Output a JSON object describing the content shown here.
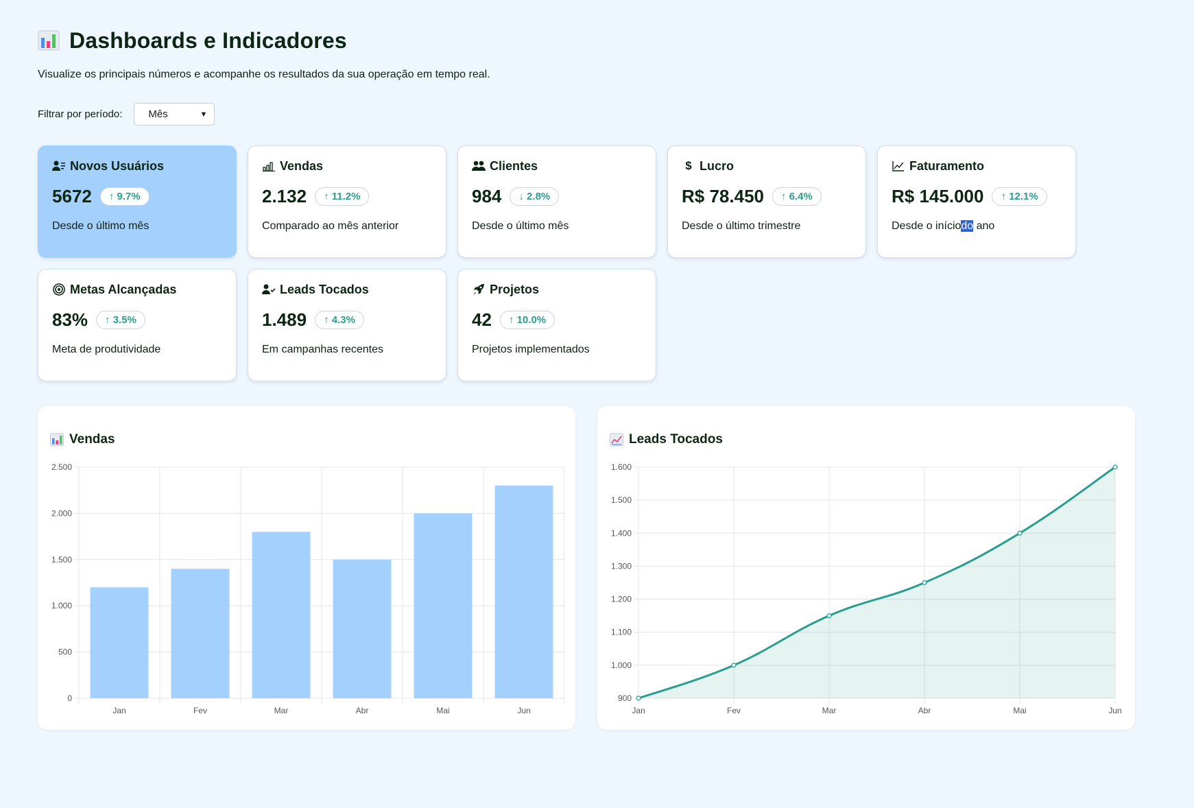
{
  "header": {
    "title": "Dashboards e Indicadores",
    "icon": "bar-chart-icon"
  },
  "subtitle": "Visualize os principais números e acompanhe os resultados da sua operação em tempo real.",
  "filter": {
    "label": "Filtrar por período:",
    "selected": "Mês",
    "options": [
      "Mês"
    ]
  },
  "colors": {
    "accent_card": "#a3d0fd",
    "badge_text": "#2a9d8f",
    "bar": "#a3d0fd",
    "line": "#2a9d8f"
  },
  "cards": [
    {
      "title": "Novos Usuários",
      "icon": "user-list-icon",
      "value": "5672",
      "delta": "↑ 9.7%",
      "desc": "Desde o último mês",
      "active": true
    },
    {
      "title": "Vendas",
      "icon": "bar-signal-icon",
      "value": "2.132",
      "delta": "↑ 11.2%",
      "desc": "Comparado ao mês anterior"
    },
    {
      "title": "Clientes",
      "icon": "users-icon",
      "value": "984",
      "delta": "↓ 2.8%",
      "desc": "Desde o último mês"
    },
    {
      "title": "Lucro",
      "icon": "dollar-icon",
      "value": "R$ 78.450",
      "delta": "↑ 6.4%",
      "desc": "Desde o último trimestre"
    },
    {
      "title": "Faturamento",
      "icon": "trend-line-icon",
      "value": "R$ 145.000",
      "delta": "↑ 12.1%",
      "desc_pre": "Desde o início",
      "desc_hl": "do",
      "desc_post": " ano"
    },
    {
      "title": "Metas Alcançadas",
      "icon": "target-icon",
      "value": "83%",
      "delta": "↑ 3.5%",
      "desc": "Meta de produtividade"
    },
    {
      "title": "Leads Tocados",
      "icon": "user-check-icon",
      "value": "1.489",
      "delta": "↑ 4.3%",
      "desc": "Em campanhas recentes"
    },
    {
      "title": "Projetos",
      "icon": "rocket-icon",
      "value": "42",
      "delta": "↑ 10.0%",
      "desc": "Projetos implementados"
    }
  ],
  "panels": {
    "vendas_title": "Vendas",
    "leads_title": "Leads Tocados"
  },
  "chart_data": [
    {
      "type": "bar",
      "title": "Vendas",
      "categories": [
        "Jan",
        "Fev",
        "Mar",
        "Abr",
        "Mai",
        "Jun"
      ],
      "values": [
        1200,
        1400,
        1800,
        1500,
        2000,
        2300
      ],
      "ylim": [
        0,
        2500
      ],
      "yticks": [
        "0",
        "500",
        "1.000",
        "1.500",
        "2.000",
        "2.500"
      ],
      "grid": true
    },
    {
      "type": "area",
      "title": "Leads Tocados",
      "categories": [
        "Jan",
        "Fev",
        "Mar",
        "Abr",
        "Mai",
        "Jun"
      ],
      "values": [
        900,
        1000,
        1150,
        1250,
        1400,
        1600
      ],
      "ylim": [
        900,
        1600
      ],
      "yticks": [
        "900",
        "1.000",
        "1.100",
        "1.200",
        "1.300",
        "1.400",
        "1.500",
        "1.600"
      ],
      "grid": true
    }
  ]
}
